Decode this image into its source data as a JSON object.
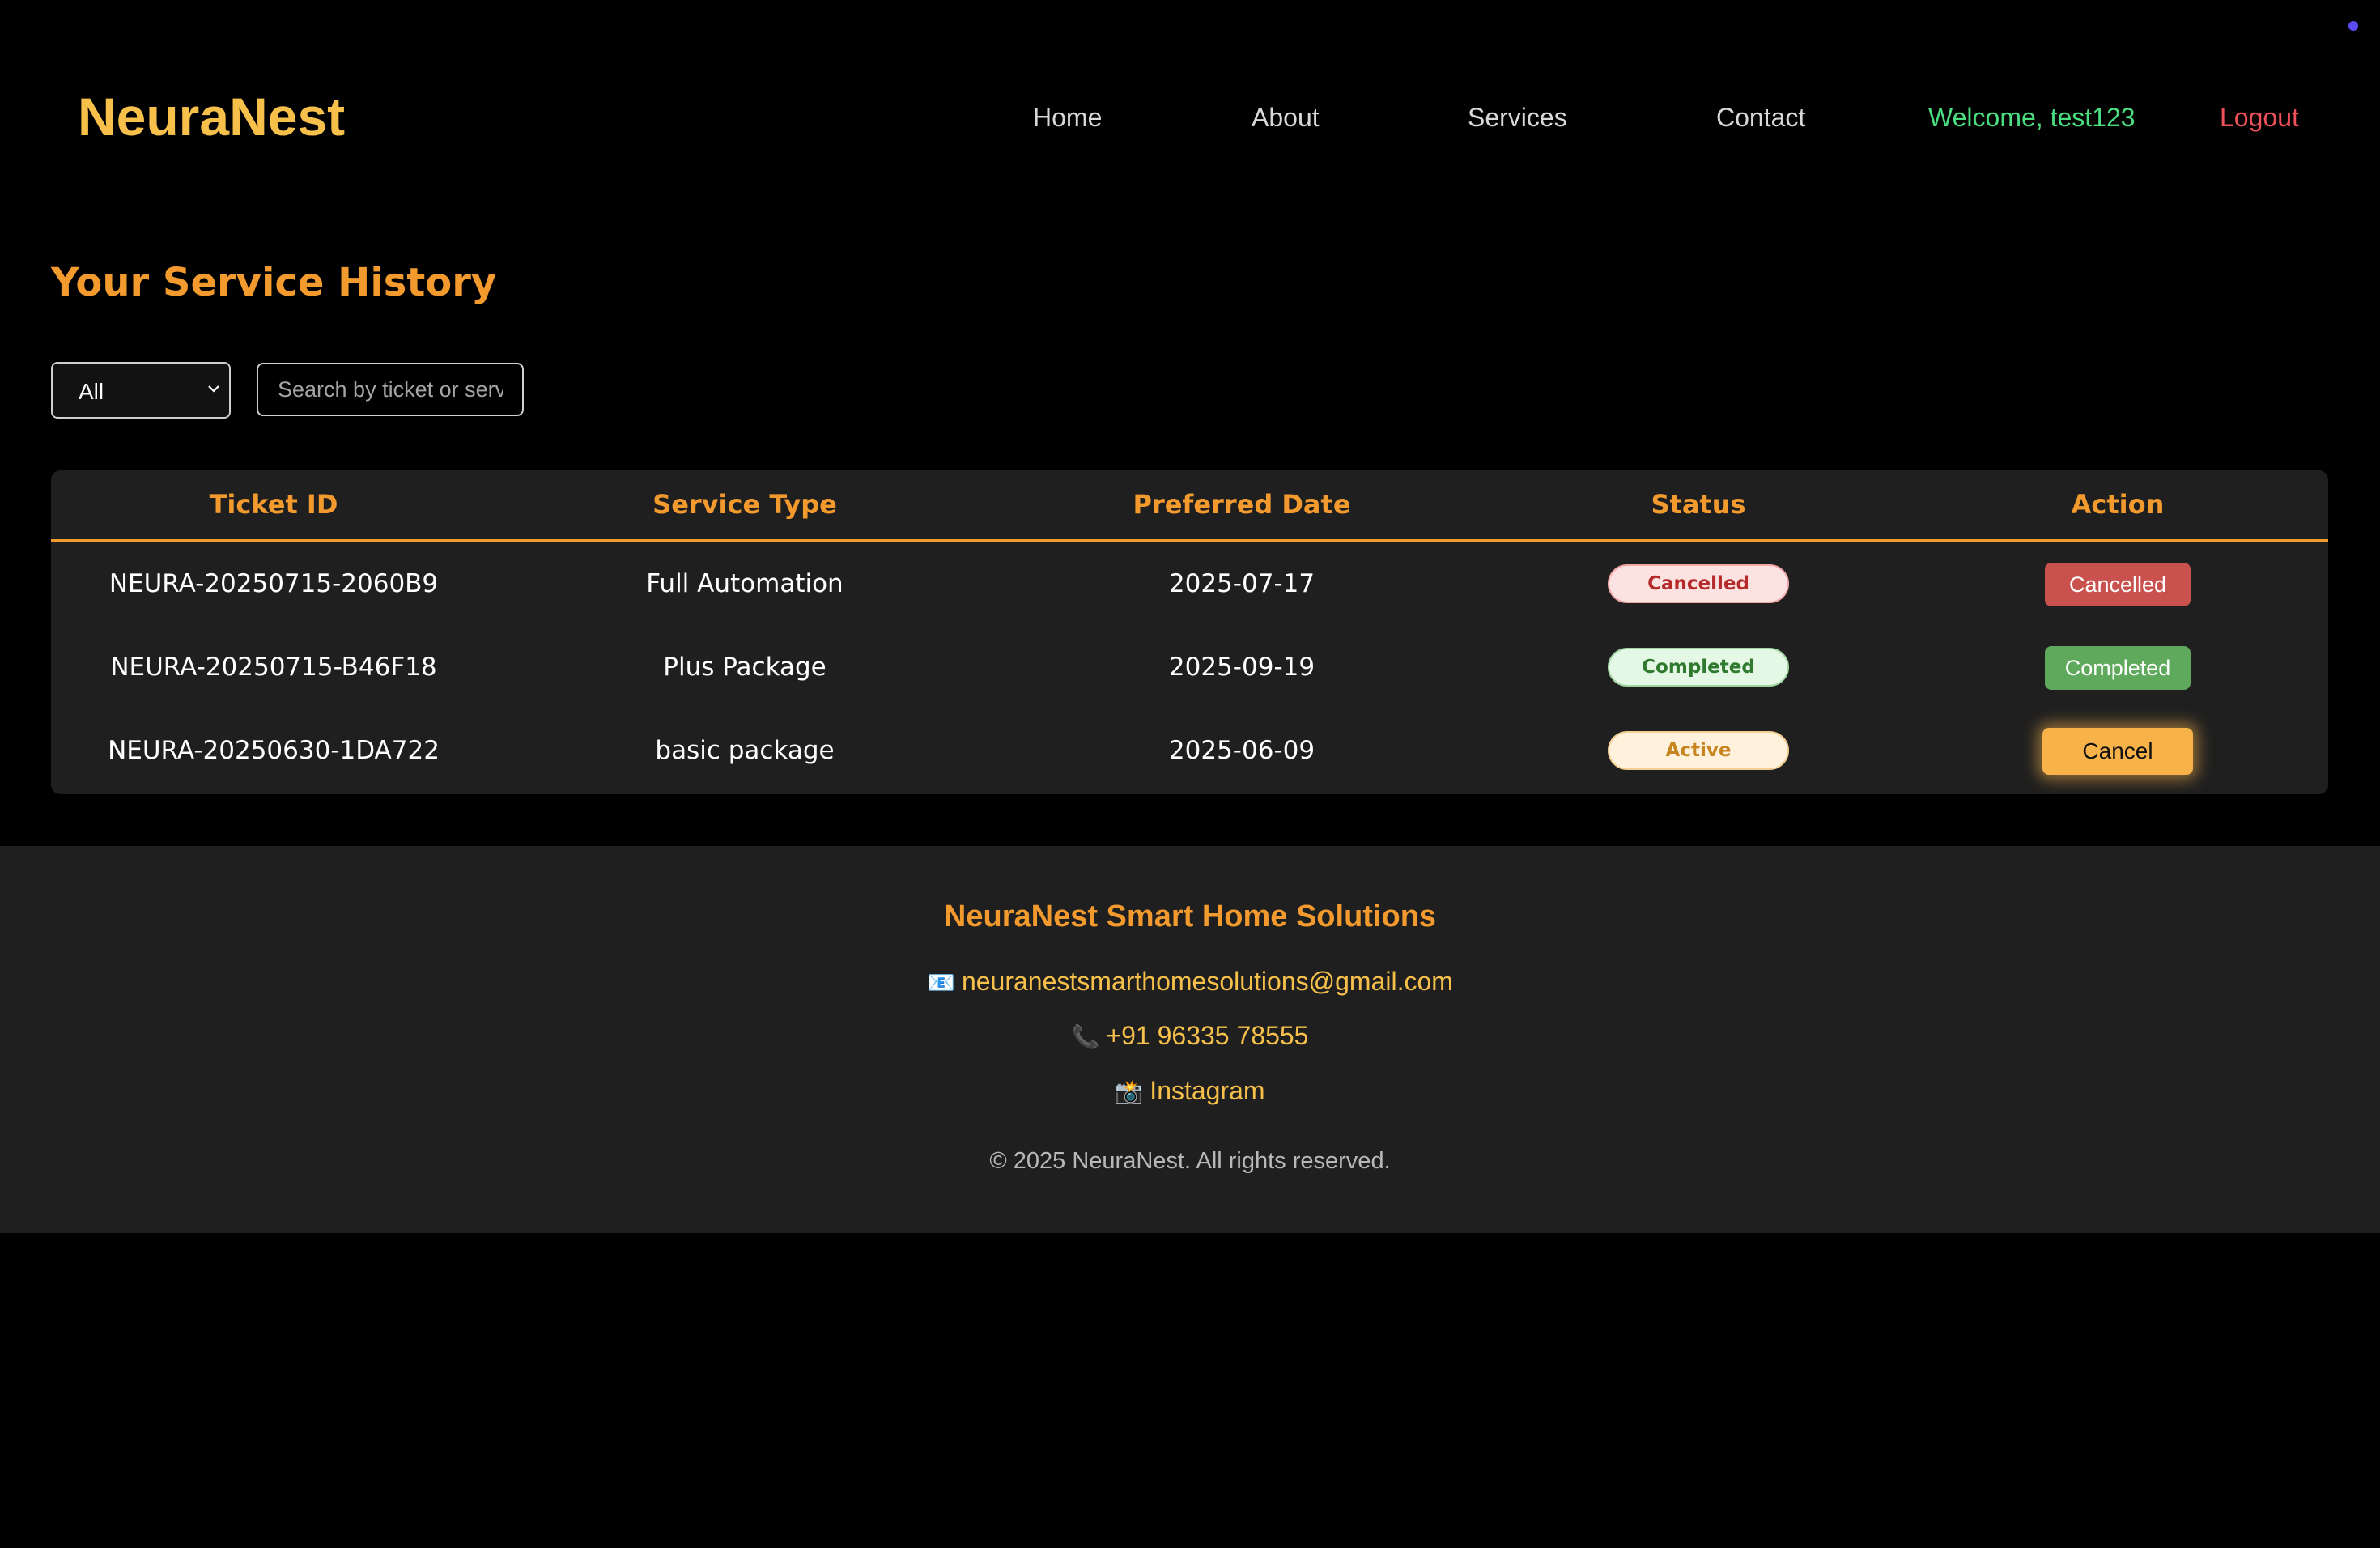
{
  "header": {
    "logo": "NeuraNest",
    "nav": {
      "home": "Home",
      "about": "About",
      "services": "Services",
      "contact": "Contact"
    },
    "welcome": "Welcome, test123",
    "logout": "Logout"
  },
  "main": {
    "title": "Your Service History",
    "filter": {
      "selected": "All"
    },
    "search": {
      "placeholder": "Search by ticket or service"
    },
    "table": {
      "headers": [
        "Ticket ID",
        "Service Type",
        "Preferred Date",
        "Status",
        "Action"
      ],
      "rows": [
        {
          "ticket_id": "NEURA-20250715-2060B9",
          "service_type": "Full Automation",
          "date": "2025-07-17",
          "status": "Cancelled",
          "action": "Cancelled"
        },
        {
          "ticket_id": "NEURA-20250715-B46F18",
          "service_type": "Plus Package",
          "date": "2025-09-19",
          "status": "Completed",
          "action": "Completed"
        },
        {
          "ticket_id": "NEURA-20250630-1DA722",
          "service_type": "basic package",
          "date": "2025-06-09",
          "status": "Active",
          "action": "Cancel"
        }
      ]
    }
  },
  "footer": {
    "title": "NeuraNest Smart Home Solutions",
    "email_icon": "📧",
    "email": "neuranestsmarthomesolutions@gmail.com",
    "phone_icon": "📞",
    "phone": "+91 96335 78555",
    "instagram_icon": "📸",
    "instagram": "Instagram",
    "copyright": "© 2025 NeuraNest. All rights reserved."
  },
  "colors": {
    "accent": "#f39a2e",
    "logo": "#f7c04a",
    "welcome": "#4ade80",
    "logout": "#f0505a",
    "cancelled": "#c9524f",
    "completed": "#5fa95c",
    "active_button": "#f7b24a"
  }
}
